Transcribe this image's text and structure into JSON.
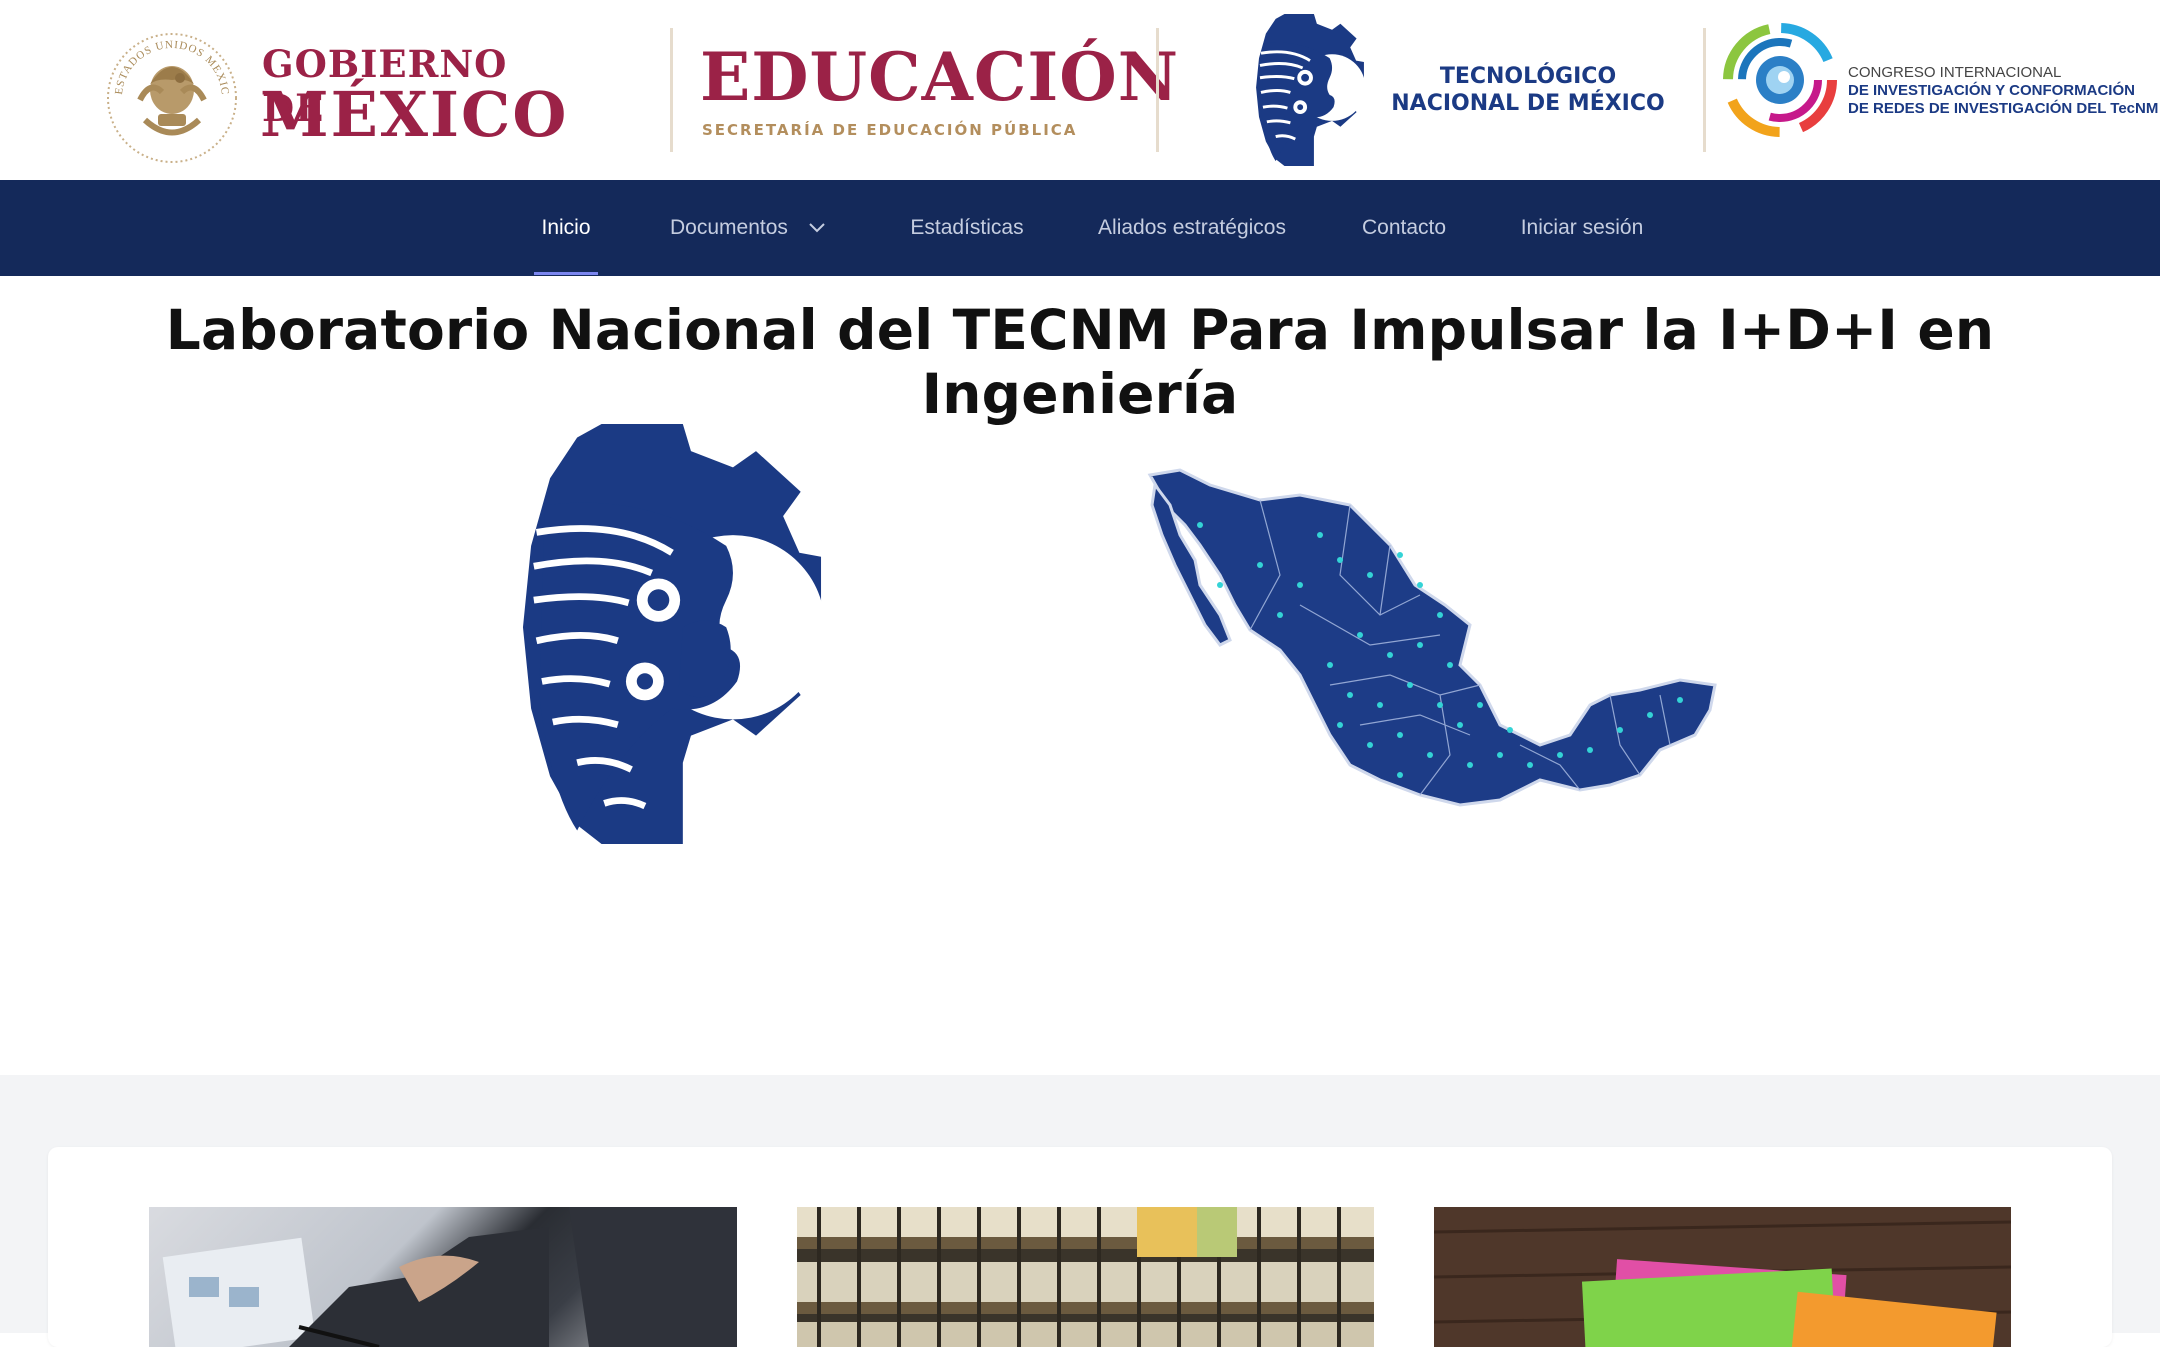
{
  "header": {
    "gob": {
      "line1": "GOBIERNO DE",
      "line2": "MÉXICO",
      "seal_text": "ESTADOS UNIDOS MEXICANOS"
    },
    "sep": {
      "title": "EDUCACIÓN",
      "subtitle": "SECRETARÍA DE EDUCACIÓN PÚBLICA"
    },
    "tecnm": {
      "line1": "TECNOLÓGICO",
      "line2": "NACIONAL DE MÉXICO"
    },
    "congreso": {
      "line1": "CONGRESO INTERNACIONAL",
      "line2": "DE INVESTIGACIÓN Y CONFORMACIÓN",
      "line3": "DE REDES DE INVESTIGACIÓN DEL TecNM"
    }
  },
  "nav": {
    "items": [
      {
        "label": "Inicio",
        "active": true
      },
      {
        "label": "Documentos",
        "icon": "chevron-down-icon"
      },
      {
        "label": "Estadísticas"
      },
      {
        "label": "Aliados estratégicos"
      },
      {
        "label": "Contacto"
      },
      {
        "label": "Iniciar sesión"
      }
    ]
  },
  "hero": {
    "title": "Laboratorio Nacional del TECNM Para Impulsar la I+D+I en Ingeniería"
  },
  "colors": {
    "nav_bg": "#14295a",
    "brand_maroon": "#9b2247",
    "brand_gold": "#b38e5d",
    "tecnm_blue": "#1b3a84",
    "underline": "#7b86ef"
  }
}
